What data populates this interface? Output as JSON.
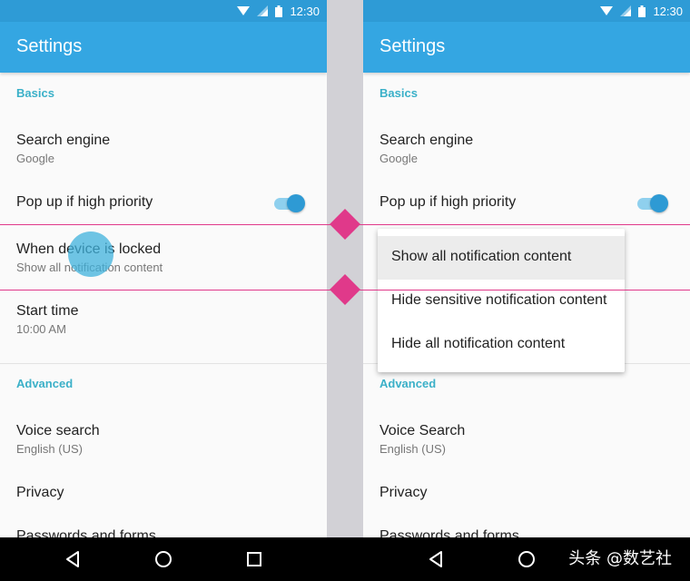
{
  "status_bar": {
    "time": "12:30"
  },
  "app_bar": {
    "title": "Settings"
  },
  "left": {
    "basics_header": "Basics",
    "search_engine": {
      "title": "Search engine",
      "value": "Google"
    },
    "popup_priority": {
      "title": "Pop up if high priority",
      "toggle_on": true
    },
    "device_locked": {
      "title": "When device is locked",
      "value": "Show all notification content"
    },
    "start_time": {
      "title": "Start time",
      "value": "10:00 AM"
    },
    "advanced_header": "Advanced",
    "voice_search": {
      "title": "Voice search",
      "value": "English (US)"
    },
    "privacy": {
      "title": "Privacy"
    },
    "passwords": {
      "title": "Passwords and forms"
    }
  },
  "right": {
    "basics_header": "Basics",
    "search_engine": {
      "title": "Search engine",
      "value": "Google"
    },
    "popup_priority": {
      "title": "Pop up if high priority",
      "toggle_on": true
    },
    "advanced_header": "Advanced",
    "voice_search": {
      "title": "Voice Search",
      "value": "English (US)"
    },
    "privacy": {
      "title": "Privacy"
    },
    "passwords": {
      "title": "Passwords and forms"
    }
  },
  "dropdown": {
    "options": [
      "Show all notification content",
      "Hide sensitive notification content",
      "Hide all notification content"
    ],
    "selected": "Show all notification content"
  },
  "colors": {
    "status_bar": "#2e9bd6",
    "app_bar": "#34a6e2",
    "accent": "#3ab0c8",
    "guide": "#e0398a"
  },
  "watermark": "头条 @数艺社",
  "nav_icons": [
    "back-icon",
    "home-icon",
    "recents-icon"
  ]
}
